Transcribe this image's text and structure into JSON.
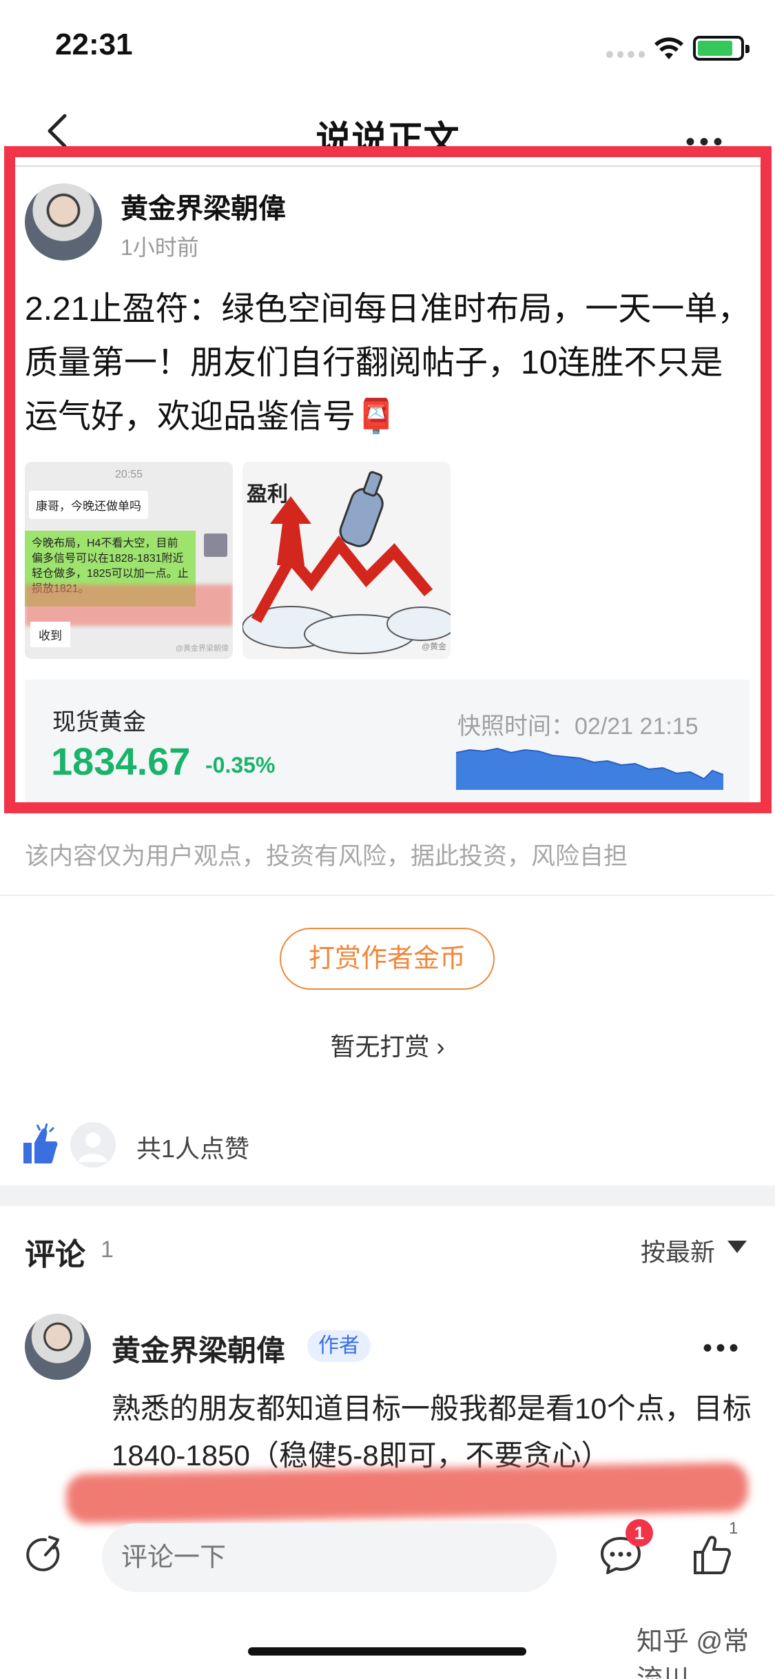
{
  "status_bar": {
    "time": "22:31"
  },
  "nav": {
    "title": "说说正文"
  },
  "post": {
    "author": "黄金界梁朝偉",
    "time": "1小时前",
    "text": "2.21止盈符：绿色空间每日准时布局，一天一单，质量第一！朋友们自行翻阅帖子，10连胜不只是运气好，欢迎品鉴信号📮",
    "thumb1": {
      "time": "20:55",
      "bubble": "康哥，今晚还做单吗",
      "green_text": "今晚布局，H4不看大空，目前偏多信号可以在1828-1831附近轻仓做多，1825可以加一点。止损放1821。",
      "received": "收到",
      "footer": "@黄金界梁朝偉"
    },
    "thumb2": {
      "title": "盈利",
      "mark": "@黄金"
    }
  },
  "quote": {
    "name": "现货黄金",
    "price": "1834.67",
    "change": "-0.35%",
    "snapshot": "快照时间：02/21 21:15"
  },
  "disclaimer": "该内容仅为用户观点，投资有风险，据此投资，风险自担",
  "reward": {
    "button": "打赏作者金币",
    "none": "暂无打赏 ›"
  },
  "likes": {
    "text": "共1人点赞"
  },
  "comments": {
    "title": "评论",
    "count": "1",
    "sort": "按最新",
    "items": [
      {
        "author": "黄金界梁朝偉",
        "badge": "作者",
        "text": "熟悉的朋友都知道目标一般我都是看10个点，目标1840-1850（稳健5-8即可，不要贪心）"
      }
    ]
  },
  "bottom_bar": {
    "input_placeholder": "评论一下",
    "comment_badge": "1",
    "like_count": "1"
  },
  "watermark": "知乎 @常流川",
  "colors": {
    "highlight_red": "#f23448",
    "up_green": "#1ab36a",
    "reward_orange": "#f0873a"
  }
}
